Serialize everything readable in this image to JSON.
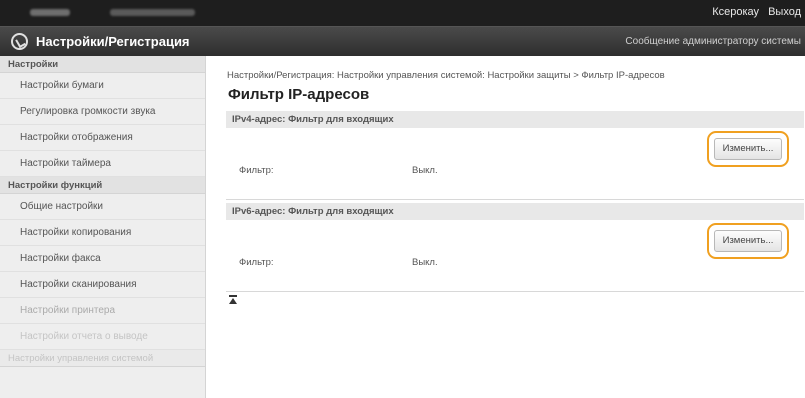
{
  "topbar": {
    "user": "Ксерокау",
    "logout": "Выход"
  },
  "header": {
    "title": "Настройки/Регистрация",
    "message": "Сообщение администратору системы"
  },
  "sidebar": {
    "section1_title": "Настройки",
    "section1_items": [
      "Настройки бумаги",
      "Регулировка громкости звука",
      "Настройки отображения",
      "Настройки таймера"
    ],
    "section2_title": "Настройки функций",
    "section2_items": [
      "Общие настройки",
      "Настройки копирования",
      "Настройки факса",
      "Настройки сканирования",
      "Настройки принтера",
      "Настройки отчета о выводе"
    ],
    "section3_title": "Настройки управления системой"
  },
  "main": {
    "breadcrumb": "Настройки/Регистрация: Настройки управления системой: Настройки защиты > Фильтр IP-адресов",
    "title": "Фильтр IP-адресов",
    "ipv4": {
      "heading": "IPv4-адрес: Фильтр для входящих",
      "edit_label": "Изменить...",
      "field_label": "Фильтр:",
      "field_value": "Выкл."
    },
    "ipv6": {
      "heading": "IPv6-адрес: Фильтр для входящих",
      "edit_label": "Изменить...",
      "field_label": "Фильтр:",
      "field_value": "Выкл."
    }
  },
  "colors": {
    "highlight": "#f0a020",
    "topbar": "#1e1e1e"
  },
  "icons": {
    "logo": "canon-logo-icon",
    "back_to_top": "back-to-top-icon"
  }
}
